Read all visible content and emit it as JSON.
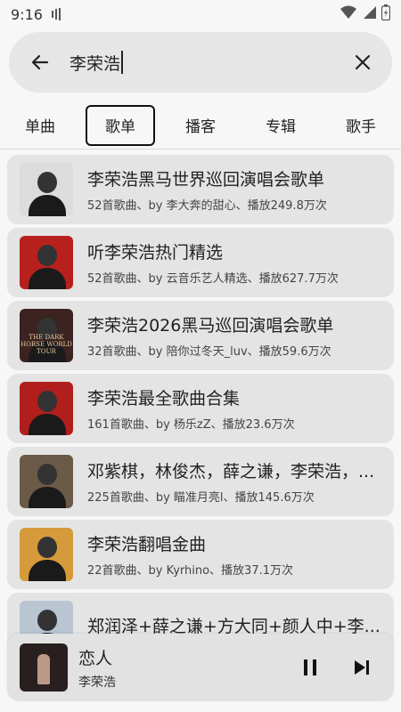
{
  "status_bar": {
    "time": "9:16",
    "icons": [
      "sim-icon",
      "wifi-icon",
      "signal-icon",
      "battery-icon"
    ]
  },
  "search": {
    "query": "李荣浩",
    "back_icon": "arrow-back-icon",
    "clear_icon": "close-icon"
  },
  "tabs": [
    {
      "label": "单曲",
      "active": false
    },
    {
      "label": "歌单",
      "active": true
    },
    {
      "label": "播客",
      "active": false
    },
    {
      "label": "专辑",
      "active": false
    },
    {
      "label": "歌手",
      "active": false
    }
  ],
  "playlists": [
    {
      "title": "李荣浩黑马世界巡回演唱会歌单",
      "subtitle": "52首歌曲、by 李大奔的甜心、播放249.8万次",
      "cover_bg": "#dcdcdc"
    },
    {
      "title": "听李荣浩热门精选",
      "subtitle": "52首歌曲、by 云音乐艺人精选、播放627.7万次",
      "cover_bg": "#b8201e"
    },
    {
      "title": "李荣浩2026黑马巡回演唱会歌单",
      "subtitle": "32首歌曲、by 陪你过冬天_luv、播放59.6万次",
      "cover_bg": "#3a2320",
      "cover_text": "THE DARK HORSE WORLD TOUR"
    },
    {
      "title": "李荣浩最全歌曲合集",
      "subtitle": "161首歌曲、by 杨乐zZ、播放23.6万次",
      "cover_bg": "#b01f1c"
    },
    {
      "title": "邓紫棋，林俊杰，薛之谦，李荣浩，...",
      "subtitle": "225首歌曲、by 瞄准月亮l、播放145.6万次",
      "cover_bg": "#6b5a48"
    },
    {
      "title": "李荣浩翻唱金曲",
      "subtitle": "22首歌曲、by Kyrhino、播放37.1万次",
      "cover_bg": "#d59a3a"
    },
    {
      "title": "郑润泽+薛之谦+方大同+颜人中+李...",
      "subtitle": "",
      "cover_bg": "#b9c6d2"
    }
  ],
  "player": {
    "title": "恋人",
    "artist": "李荣浩",
    "pause_icon": "pause-icon",
    "next_icon": "skip-next-icon"
  }
}
